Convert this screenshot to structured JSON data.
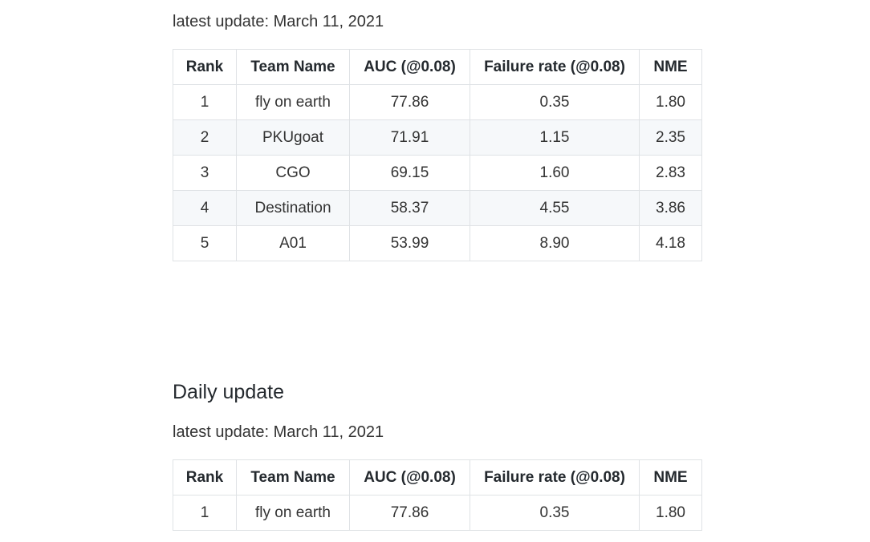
{
  "updates": {
    "first_latest_update": "latest update: March 11, 2021",
    "daily_heading": "Daily update",
    "second_latest_update": "latest update: March 11, 2021"
  },
  "table_headers": [
    "Rank",
    "Team Name",
    "AUC (@0.08)",
    "Failure rate (@0.08)",
    "NME"
  ],
  "leaderboard": [
    {
      "rank": "1",
      "team": "fly on earth",
      "auc": "77.86",
      "failure": "0.35",
      "nme": "1.80"
    },
    {
      "rank": "2",
      "team": "PKUgoat",
      "auc": "71.91",
      "failure": "1.15",
      "nme": "2.35"
    },
    {
      "rank": "3",
      "team": "CGO",
      "auc": "69.15",
      "failure": "1.60",
      "nme": "2.83"
    },
    {
      "rank": "4",
      "team": "Destination",
      "auc": "58.37",
      "failure": "4.55",
      "nme": "3.86"
    },
    {
      "rank": "5",
      "team": "A01",
      "auc": "53.99",
      "failure": "8.90",
      "nme": "4.18"
    }
  ],
  "daily_leaderboard": [
    {
      "rank": "1",
      "team": "fly on earth",
      "auc": "77.86",
      "failure": "0.35",
      "nme": "1.80"
    }
  ]
}
